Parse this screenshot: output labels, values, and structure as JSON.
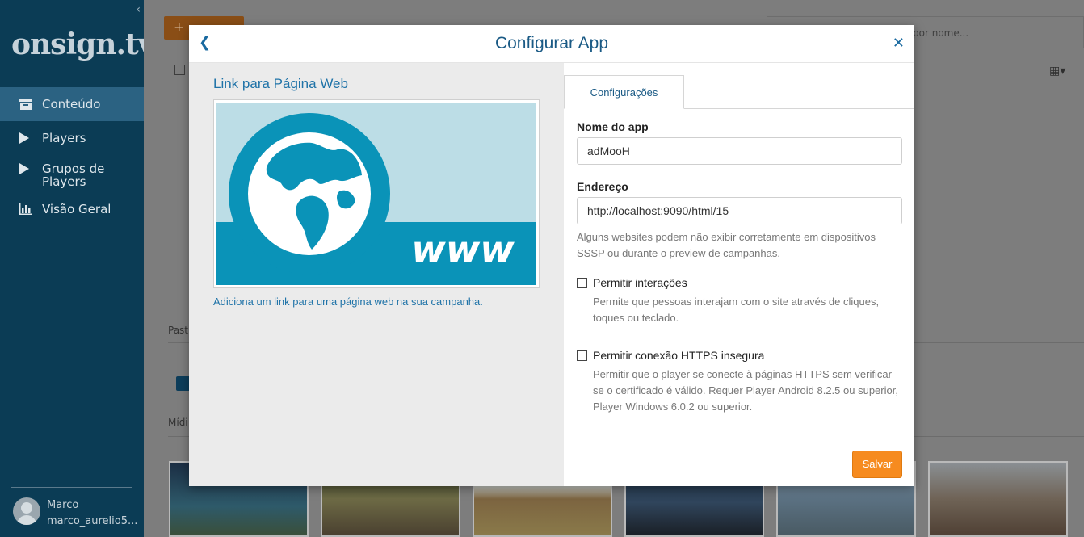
{
  "sidebar": {
    "logo": "onsign.tv",
    "collapse_icon": "chevron-left-icon",
    "items": [
      {
        "label": "Conteúdo",
        "icon": "archive-icon",
        "active": true
      },
      {
        "label": "Players",
        "icon": "play-icon",
        "active": false
      },
      {
        "label": "Grupos de Players",
        "icon": "play-icon",
        "active": false
      },
      {
        "label": "Visão Geral",
        "icon": "bar-chart-icon",
        "active": false
      }
    ],
    "user": {
      "name": "Marco",
      "email": "marco_aurelio5..."
    }
  },
  "background": {
    "search_placeholder": "por nome...",
    "pasta_label": "Past",
    "midia_label": "Mídi"
  },
  "modal": {
    "title": "Configurar App",
    "back_icon": "chevron-left-icon",
    "close_icon": "close-icon",
    "app": {
      "name": "Link para Página Web",
      "image_text": "www",
      "description": "Adiciona um link para uma página web na sua campanha."
    },
    "tabs": [
      {
        "label": "Configurações",
        "active": true
      }
    ],
    "form": {
      "app_name_label": "Nome do app",
      "app_name_value": "adMooH",
      "address_label": "Endereço",
      "address_value": "http://localhost:9090/html/15",
      "address_help": "Alguns websites podem não exibir corretamente em dispositivos SSSP ou durante o preview de campanhas.",
      "allow_interactions_label": "Permitir interações",
      "allow_interactions_checked": false,
      "allow_interactions_help": "Permite que pessoas interajam com o site através de cliques, toques ou teclado.",
      "allow_insecure_label": "Permitir conexão HTTPS insegura",
      "allow_insecure_checked": false,
      "allow_insecure_help": "Permitir que o player se conecte à páginas HTTPS sem verificar se o certificado é válido. Requer Player Android 8.2.5 ou superior, Player Windows 6.0.2 ou superior.",
      "save_label": "Salvar"
    }
  },
  "colors": {
    "sidebar_bg": "#0b3c55",
    "accent_blue": "#1f73a8",
    "save_orange": "#f68b1f",
    "image_teal": "#0a93b8"
  }
}
